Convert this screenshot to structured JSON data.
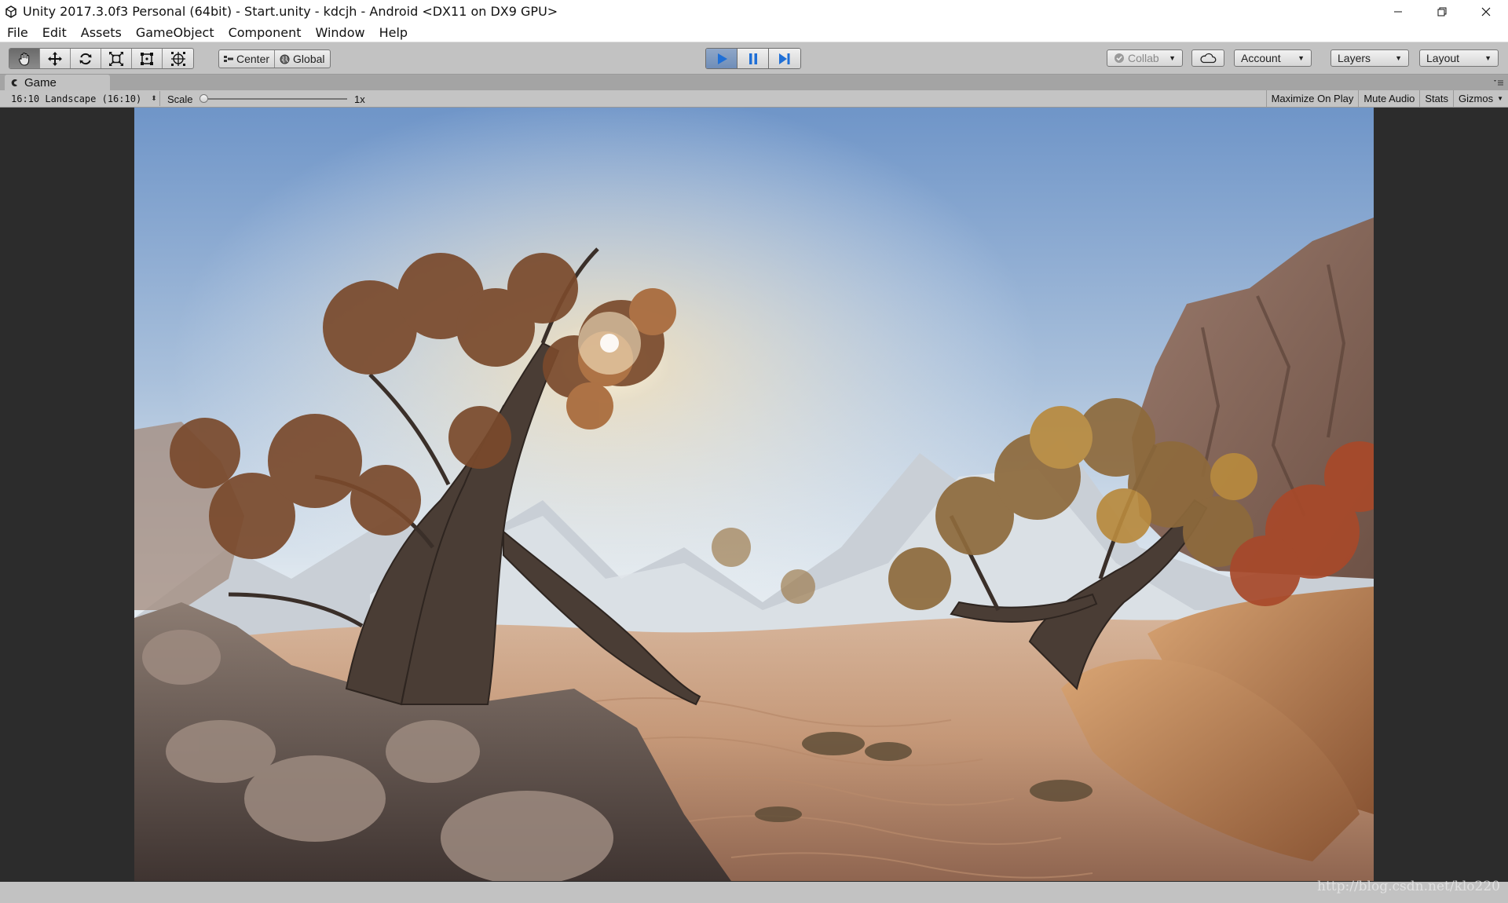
{
  "window": {
    "title": "Unity 2017.3.0f3 Personal (64bit) - Start.unity - kdcjh - Android <DX11 on DX9 GPU>",
    "controls": [
      "minimize",
      "restore",
      "close"
    ]
  },
  "menubar": {
    "items": [
      "File",
      "Edit",
      "Assets",
      "GameObject",
      "Component",
      "Window",
      "Help"
    ]
  },
  "toolbar": {
    "tools": [
      "hand-tool",
      "move-tool",
      "rotate-tool",
      "scale-tool",
      "rect-tool",
      "transform-tool"
    ],
    "active_tool": "hand-tool",
    "pivot_mode": "Center",
    "pivot_rotation": "Global",
    "playing": true,
    "collab": "Collab",
    "account": "Account",
    "layers": "Layers",
    "layout": "Layout"
  },
  "game_view": {
    "tab_label": "Game",
    "aspect": "16:10 Landscape (16:10)",
    "scale_label": "Scale",
    "scale_value": "1x",
    "scale_fraction": 0.0,
    "maximize_on_play": "Maximize On Play",
    "mute_audio": "Mute Audio",
    "stats": "Stats",
    "gizmos": "Gizmos"
  },
  "watermark": "http://blog.csdn.net/klo220",
  "colors": {
    "play_active": "#6f8db8",
    "toolbar_bg": "#c2c2c2",
    "viewport_bg": "#2c2c2c"
  }
}
